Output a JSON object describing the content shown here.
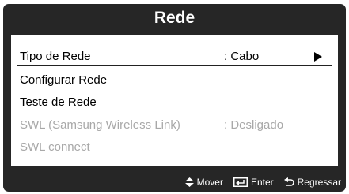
{
  "menu": {
    "title": "Rede",
    "items": [
      {
        "label": "Tipo de Rede",
        "value": ": Cabo"
      },
      {
        "label": "Configurar Rede",
        "value": ""
      },
      {
        "label": "Teste de Rede",
        "value": ""
      },
      {
        "label": "SWL (Samsung Wireless Link)",
        "value": ": Desligado"
      },
      {
        "label": "SWL connect",
        "value": ""
      }
    ]
  },
  "footer": {
    "move_label": "Mover",
    "enter_label": "Enter",
    "return_label": "Regressar"
  }
}
